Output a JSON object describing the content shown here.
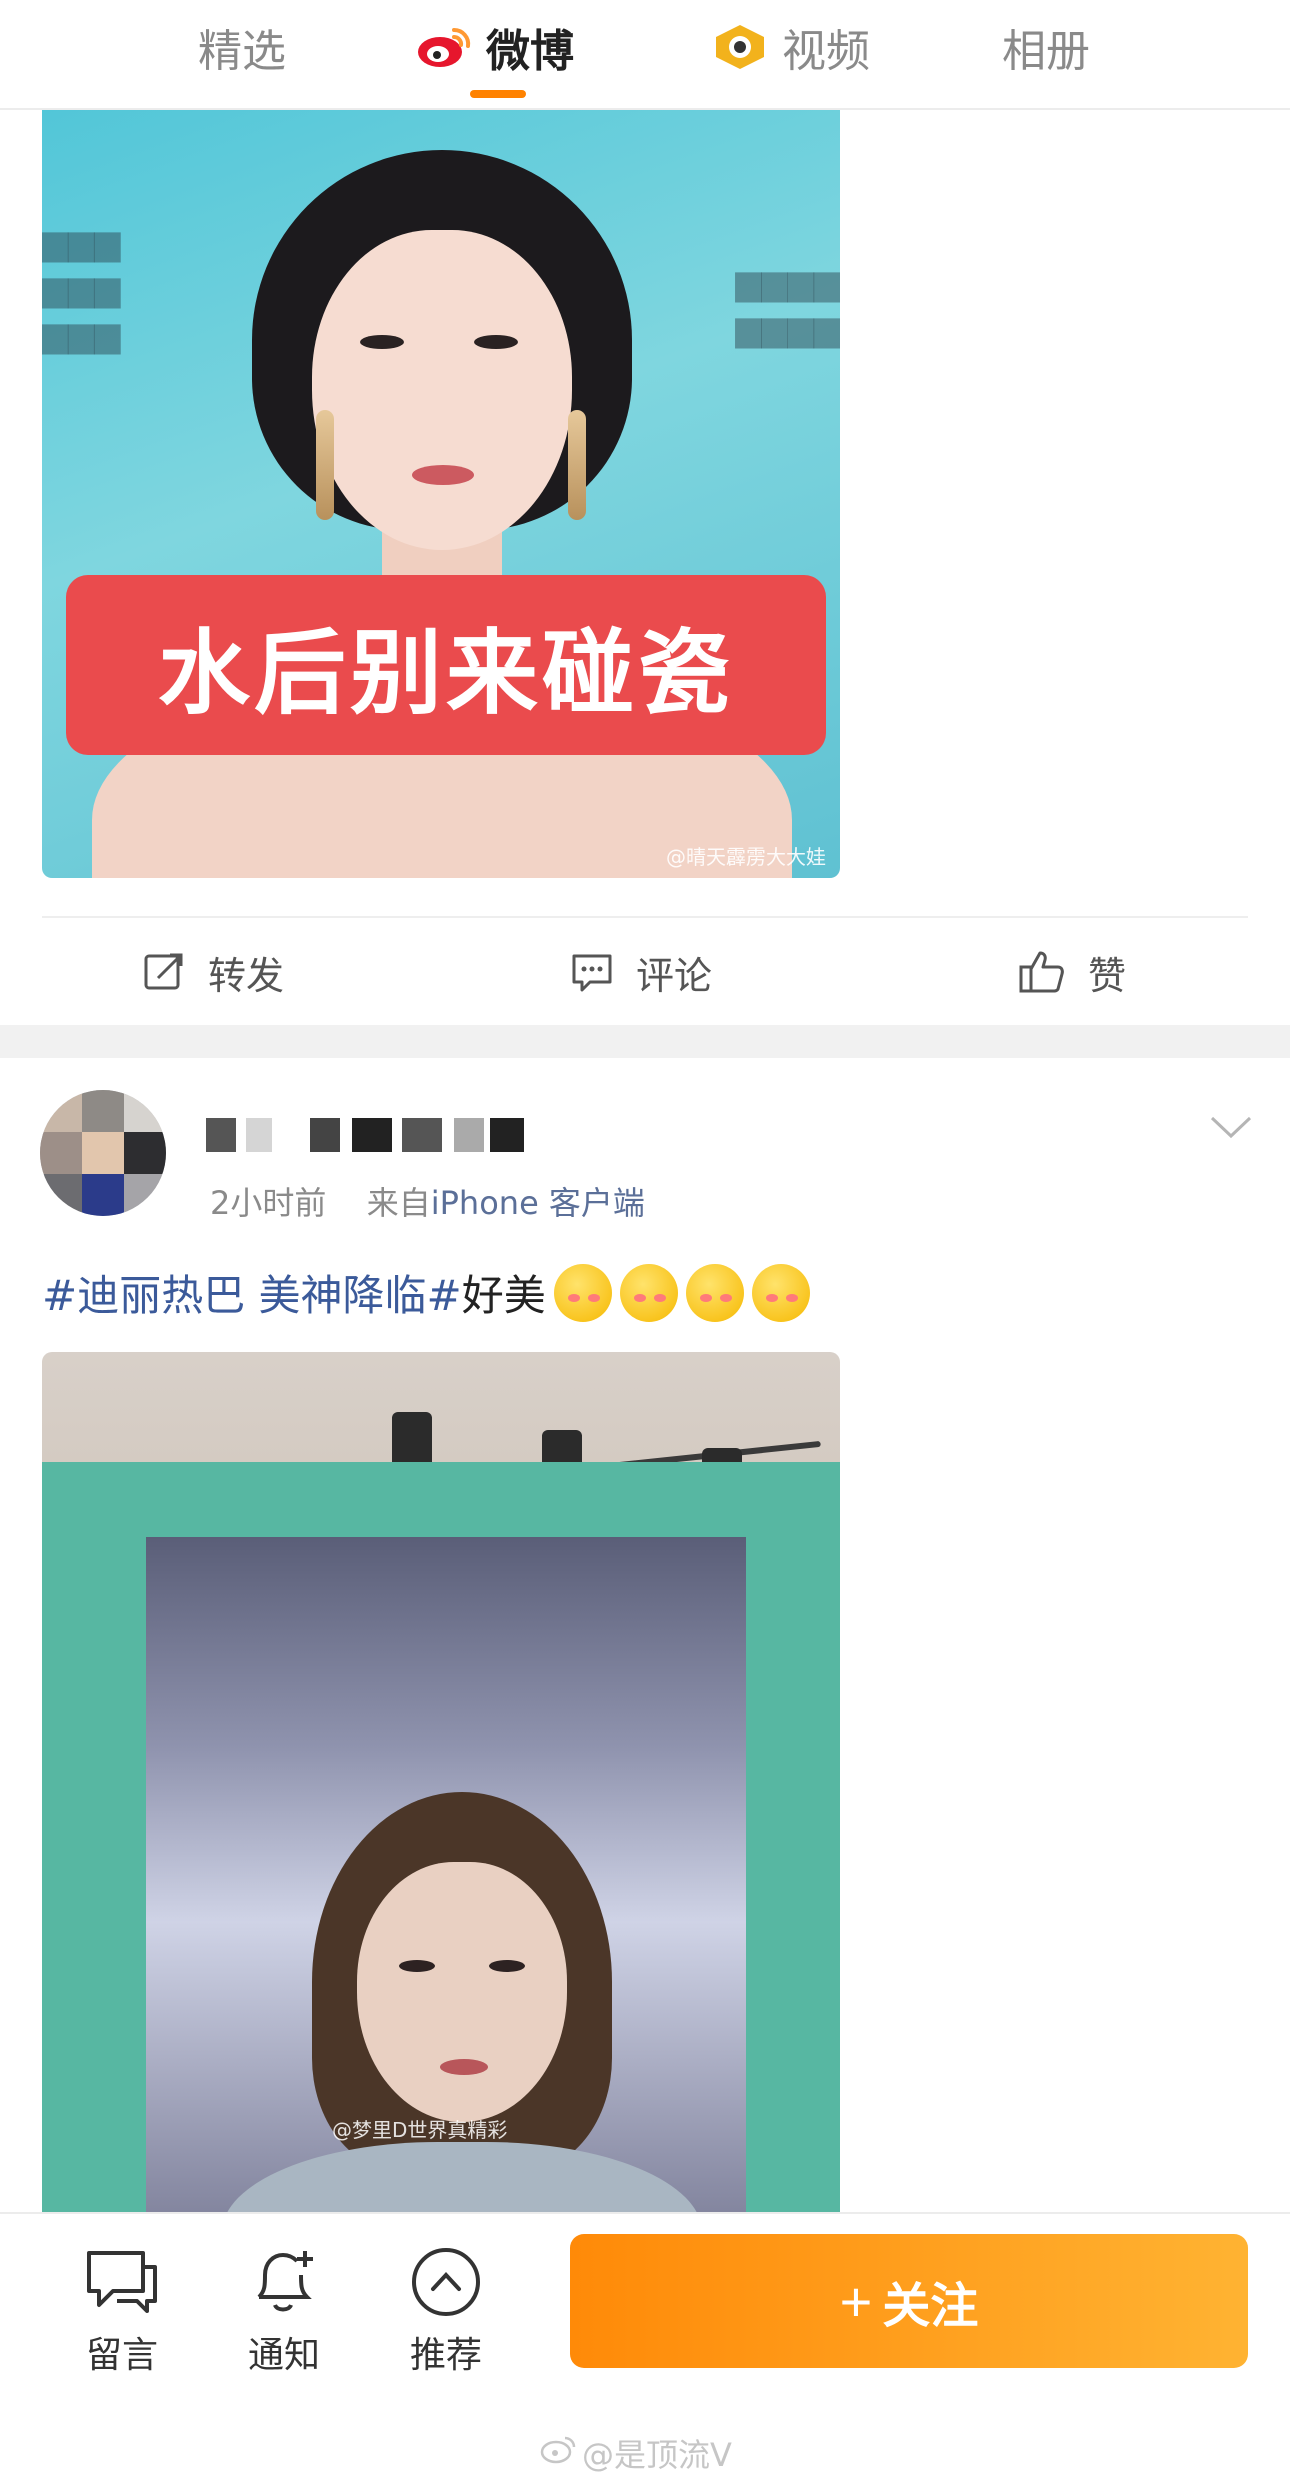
{
  "top_tabs": [
    {
      "label": "精选",
      "active": false
    },
    {
      "label": "微博",
      "active": true
    },
    {
      "label": "视频",
      "active": false
    },
    {
      "label": "相册",
      "active": false
    }
  ],
  "accent_color": "#ff8200",
  "post1": {
    "image_banner_text": "水后别来碰瓷",
    "image_watermark": "@晴天霹雳大大娃",
    "actions": {
      "repost": "转发",
      "comment": "评论",
      "like": "赞"
    }
  },
  "post2": {
    "time": "2小时前",
    "source_prefix": "来自",
    "source": "iPhone 客户端",
    "text": {
      "hashtag": "#迪丽热巴 美神降临#",
      "body": "好美"
    },
    "image_watermark": "@梦里D世界真精彩"
  },
  "bottom_bar": {
    "message": "留言",
    "notify": "通知",
    "recommend": "推荐",
    "follow": "关注",
    "follow_color": "#ff8a08"
  },
  "footer_watermark": "@是顶流V"
}
